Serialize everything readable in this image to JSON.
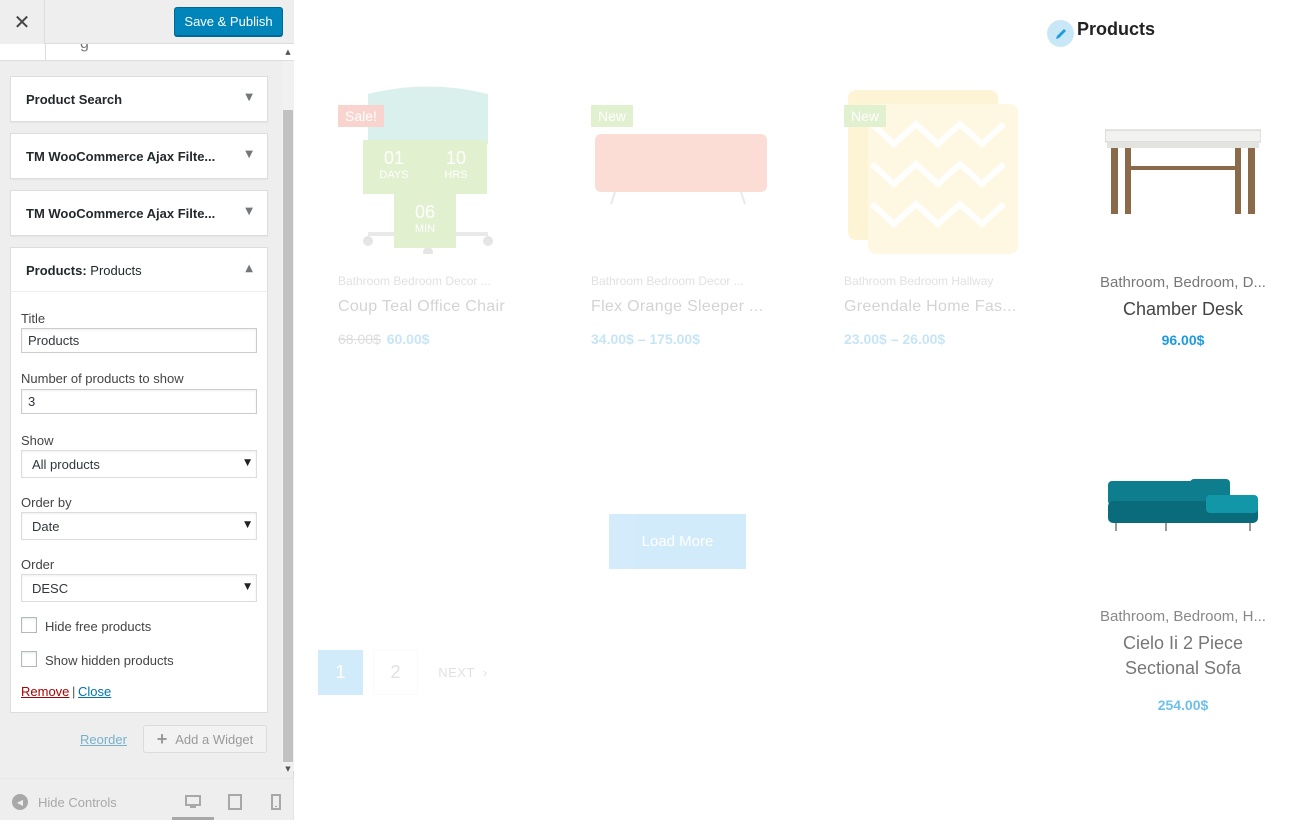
{
  "topbar": {
    "close_glyph": "✕",
    "publish_label": "Save & Publish"
  },
  "widgets": [
    {
      "title": "Product Search",
      "toggle": "▼"
    },
    {
      "title": "TM WooCommerce Ajax Filte...",
      "toggle": "▼"
    },
    {
      "title": "TM WooCommerce Ajax Filte...",
      "toggle": "▼"
    }
  ],
  "products_widget": {
    "title_prefix": "Products:",
    "title_suffix": " Products",
    "toggle": "▲",
    "fields": {
      "title_label": "Title",
      "title_value": "Products",
      "number_label": "Number of products to show",
      "number_value": "3",
      "show_label": "Show",
      "show_value": "All products",
      "orderby_label": "Order by",
      "orderby_value": "Date",
      "order_label": "Order",
      "order_value": "DESC",
      "hide_free_label": "Hide free products",
      "show_hidden_label": "Show hidden products"
    },
    "remove_label": "Remove",
    "separator": "|",
    "close_label": "Close"
  },
  "sidebar_actions": {
    "reorder_label": "Reorder",
    "add_widget_label": "Add a Widget"
  },
  "footer": {
    "hide_controls_label": "Hide Controls"
  },
  "preview": {
    "side_title": "Products",
    "products": [
      {
        "badge": "Sale!",
        "badge_color": "#e9573f",
        "cats": "Bathroom Bedroom Decor ...",
        "name": "Coup Teal Office Chair",
        "price_old": "68.00$",
        "price": "60.00$",
        "countdown": [
          {
            "num": "01",
            "unit": "DAYS"
          },
          {
            "num": "10",
            "unit": "HRS"
          },
          {
            "num": "06",
            "unit": "MIN"
          }
        ]
      },
      {
        "badge": "New",
        "badge_color": "#8cc63f",
        "cats": "Bathroom Bedroom Decor ...",
        "name": "Flex Orange Sleeper ...",
        "price_old": "",
        "price": "34.00$ – 175.00$"
      },
      {
        "badge": "New",
        "badge_color": "#8cc63f",
        "cats": "Bathroom Bedroom Hallway",
        "name": "Greendale Home Fas...",
        "price_old": "",
        "price": "23.00$ – 26.00$"
      }
    ],
    "load_more": "Load More",
    "pagination": {
      "page1": "1",
      "page2": "2",
      "next": "NEXT"
    },
    "side_products": [
      {
        "cats": "Bathroom, Bedroom, D...",
        "name": "Chamber Desk",
        "price": "96.00$"
      },
      {
        "cats": "Bathroom, Bedroom, H...",
        "name": "Cielo Ii 2 Piece Sectional Sofa",
        "price": "254.00$"
      }
    ]
  },
  "colors": {
    "accent": "#0085ba",
    "link": "#0073aa",
    "remove": "#a00",
    "shop_blue": "#1e9be0",
    "sale": "#e9573f",
    "new": "#8cc63f"
  }
}
